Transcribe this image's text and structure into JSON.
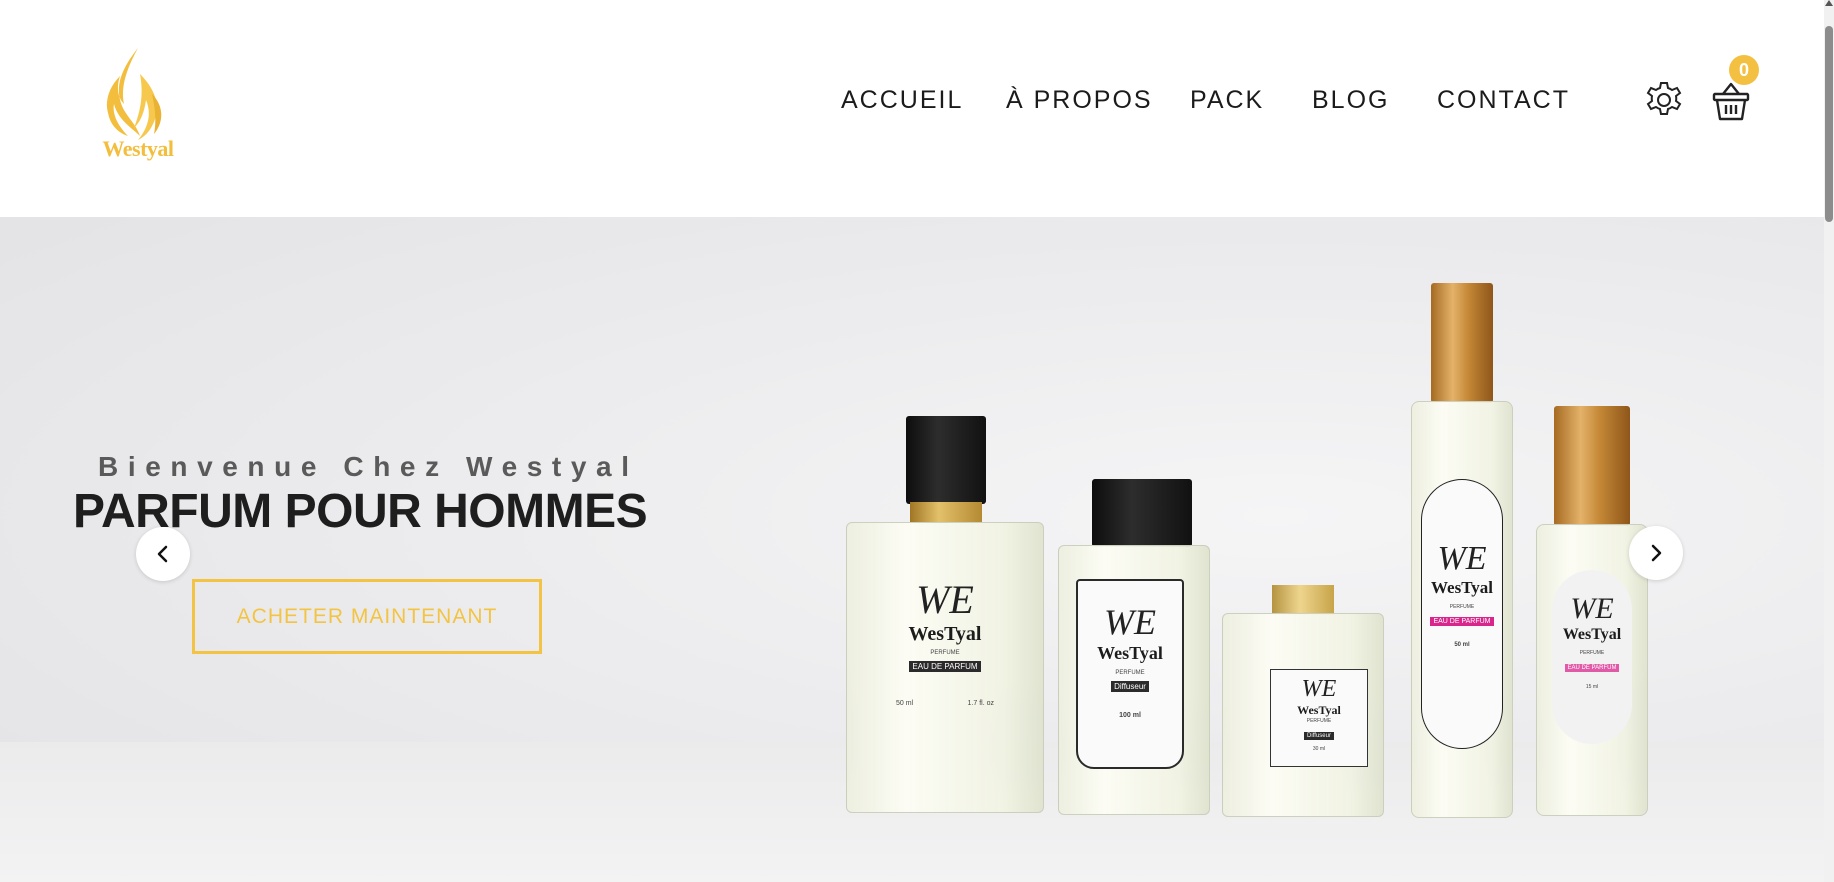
{
  "brand": {
    "name": "Westyal",
    "color": "#f3be3e"
  },
  "nav": {
    "items": [
      {
        "label": "ACCUEIL"
      },
      {
        "label": "À PROPOS"
      },
      {
        "label": "PACK"
      },
      {
        "label": "BLOG"
      },
      {
        "label": "CONTACT"
      }
    ]
  },
  "header_icons": {
    "settings_icon": "gear-icon",
    "cart_icon": "basket-icon",
    "cart_count": "0"
  },
  "hero": {
    "welcome": "Bienvenue Chez Westyal",
    "headline": "PARFUM POUR HOMMES",
    "cta_label": "ACHETER MAINTENANT",
    "prev_icon": "chevron-left-icon",
    "next_icon": "chevron-right-icon"
  },
  "bottles": {
    "b1": {
      "logo": "WE",
      "name": "WesTyal",
      "line": "PERFUME",
      "tag": "EAU DE PARFUM",
      "size_left": "50 ml",
      "size_right": "1.7 fl. oz"
    },
    "b2": {
      "logo": "WE",
      "name": "WesTyal",
      "line": "PERFUME",
      "tag": "Diffuseur",
      "size": "100 ml"
    },
    "b3": {
      "logo": "WE",
      "name": "WesTyal",
      "line": "PERFUME",
      "tag": "Diffuseur",
      "size": "30 ml"
    },
    "b4": {
      "logo": "WE",
      "name": "WesTyal",
      "line": "PERFUME",
      "tag": "EAU DE PARFUM",
      "size": "50 ml"
    },
    "b5": {
      "logo": "WE",
      "name": "WesTyal",
      "line": "PERFUME",
      "tag": "EAU DE PARFUM",
      "size": "15 ml"
    }
  },
  "colors": {
    "accent": "#f3c443",
    "tag_dark": "#2b2b2b",
    "tag_pink": "#d8268c"
  }
}
